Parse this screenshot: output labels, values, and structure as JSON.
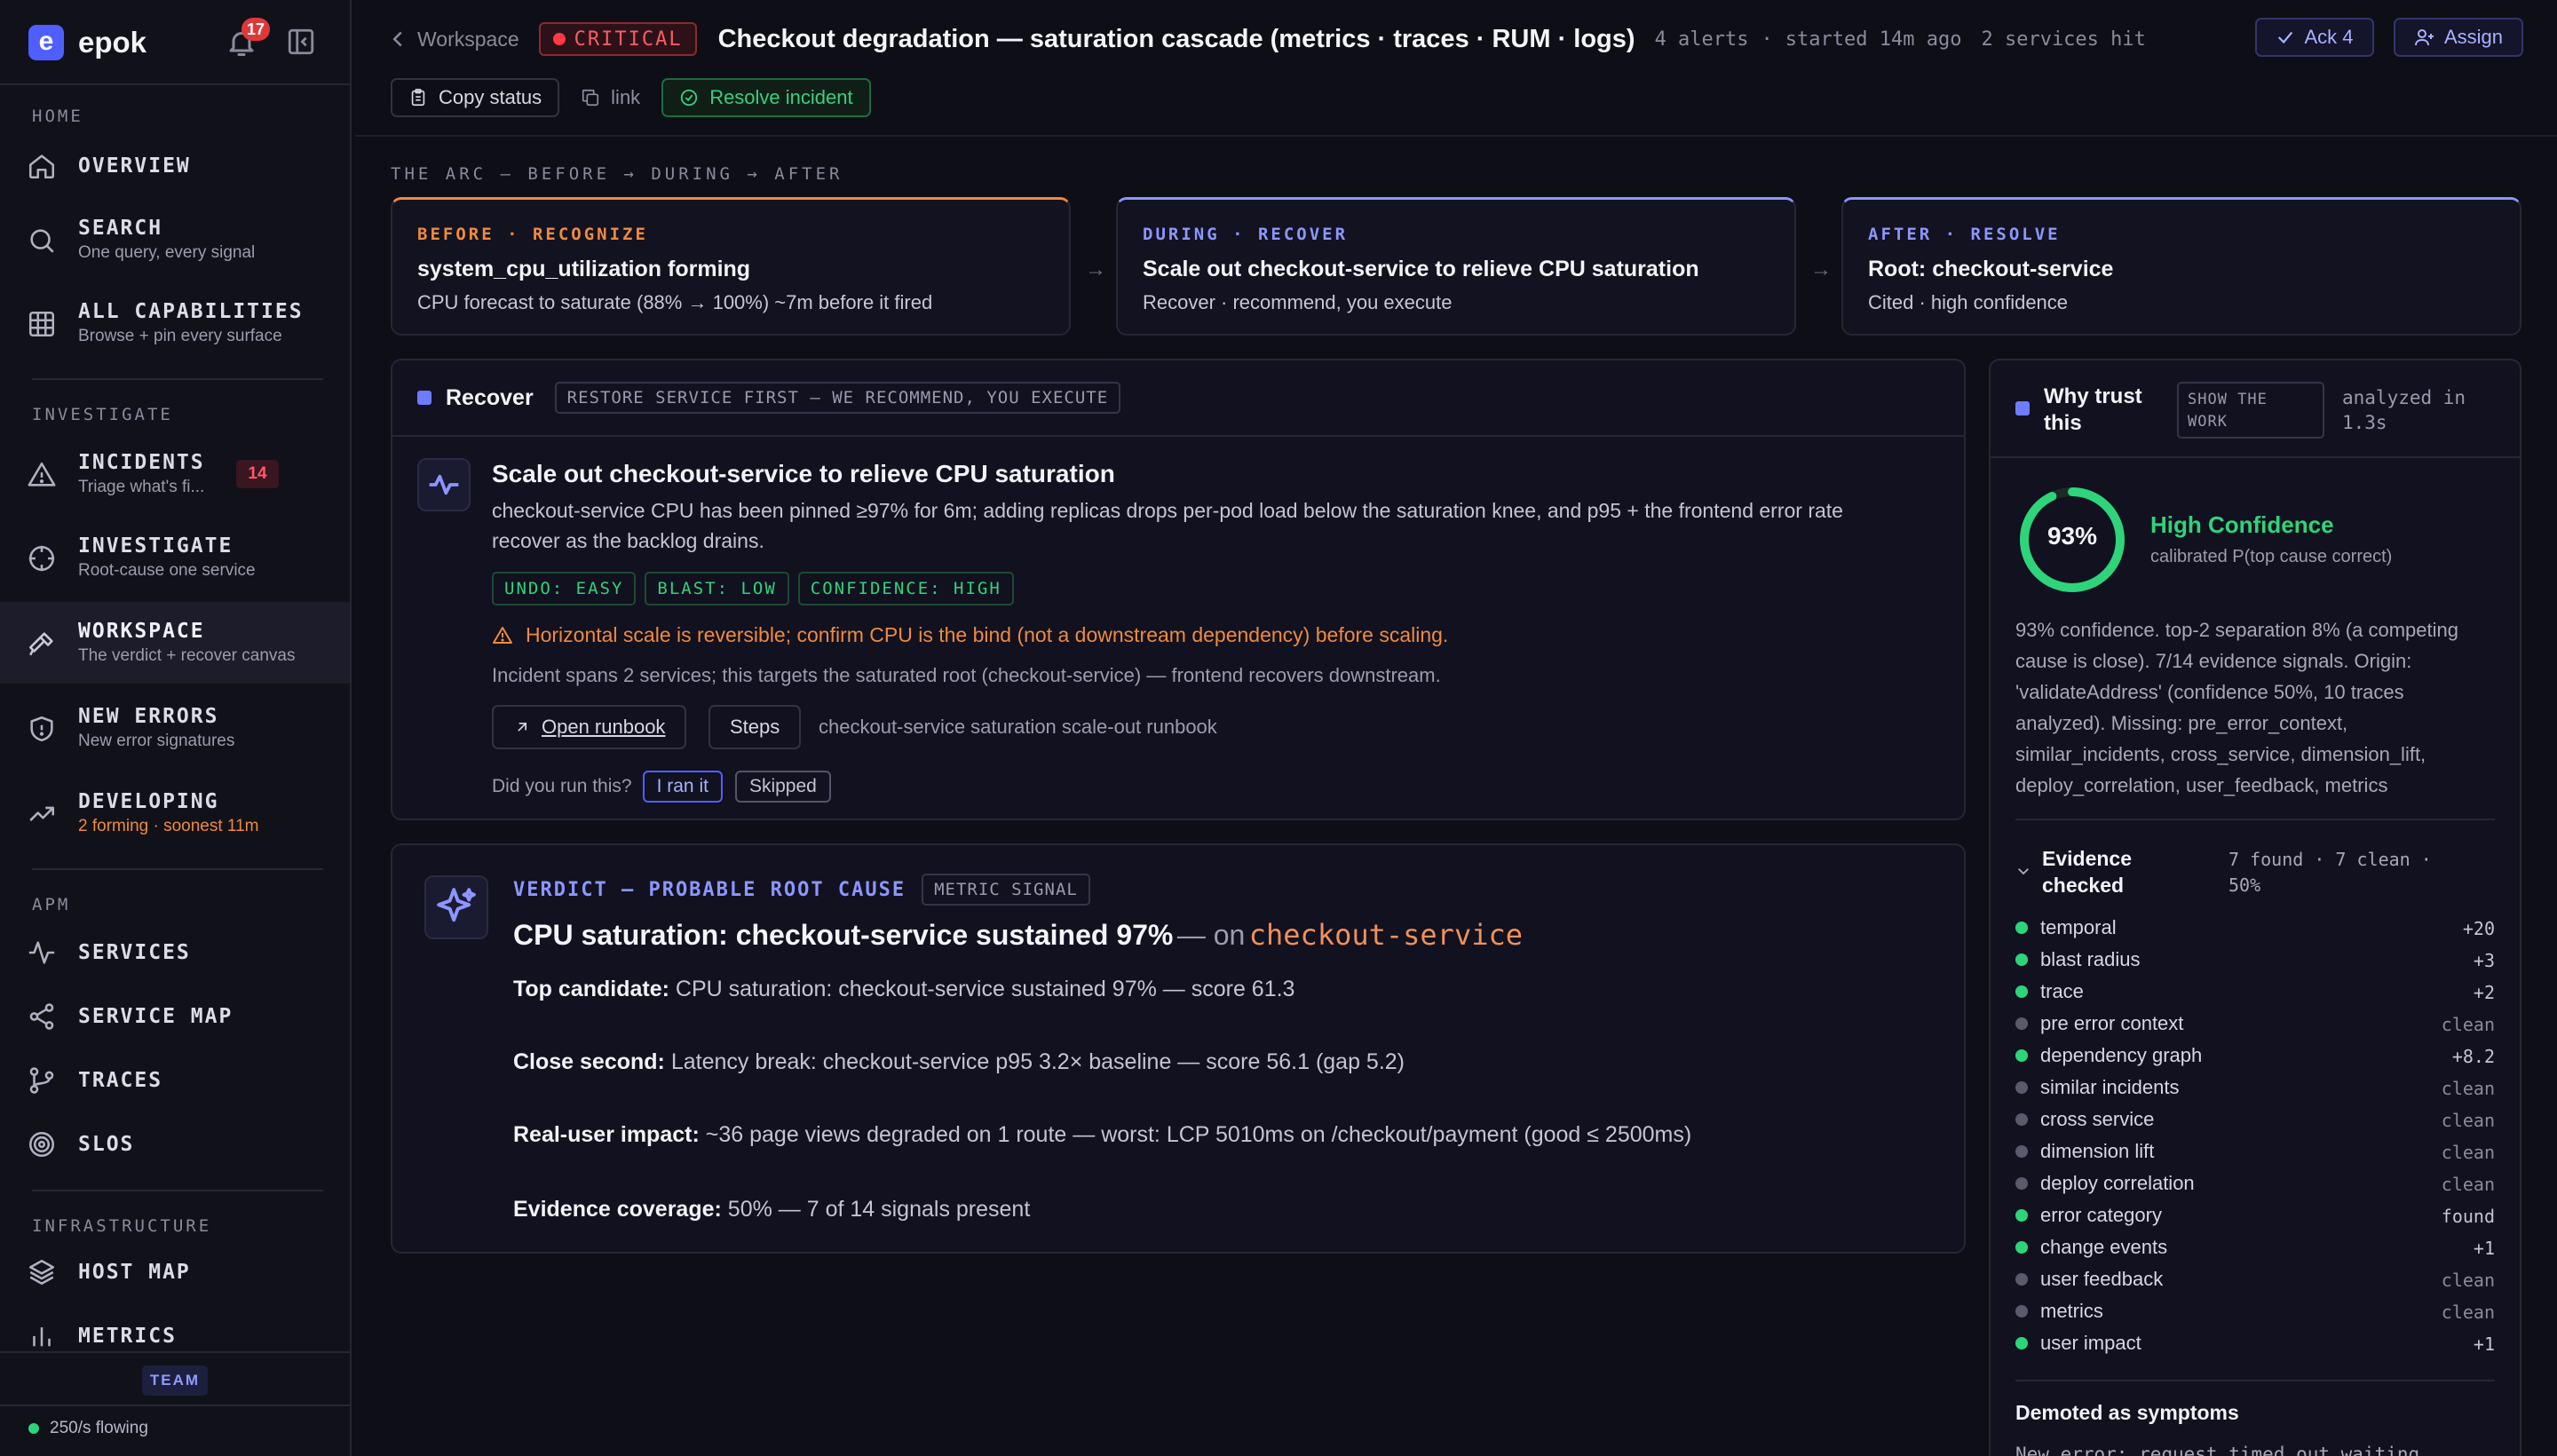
{
  "brand": {
    "name": "epok",
    "logo_letter": "e",
    "notif_count": "17"
  },
  "sidebar": {
    "sections": {
      "home": "HOME",
      "investigate": "INVESTIGATE",
      "apm": "APM",
      "infrastructure": "INFRASTRUCTURE"
    },
    "items": [
      {
        "label": "OVERVIEW",
        "icon": "home-icon"
      },
      {
        "label": "SEARCH",
        "sub": "One query, every signal",
        "icon": "search-icon"
      },
      {
        "label": "ALL CAPABILITIES",
        "sub": "Browse + pin every surface",
        "icon": "grid-icon"
      },
      {
        "label": "INCIDENTS",
        "sub": "Triage what's fi...",
        "badge": "14",
        "icon": "alert-triangle-icon"
      },
      {
        "label": "INVESTIGATE",
        "sub": "Root-cause one service",
        "icon": "crosshair-icon"
      },
      {
        "label": "WORKSPACE",
        "sub": "The verdict + recover canvas",
        "icon": "hammer-icon",
        "active": true
      },
      {
        "label": "NEW ERRORS",
        "sub": "New error signatures",
        "icon": "shield-icon"
      },
      {
        "label": "DEVELOPING",
        "sub": "2 forming · soonest 11m",
        "icon": "trend-up-icon"
      },
      {
        "label": "SERVICES",
        "icon": "pulse-icon"
      },
      {
        "label": "SERVICE MAP",
        "icon": "share-icon"
      },
      {
        "label": "TRACES",
        "icon": "branch-icon"
      },
      {
        "label": "SLOS",
        "icon": "target-icon"
      },
      {
        "label": "HOST MAP",
        "icon": "layers-icon"
      },
      {
        "label": "METRICS",
        "icon": "bar-chart-icon"
      }
    ],
    "team_label": "TEAM",
    "flow_status": "250/s flowing"
  },
  "header": {
    "breadcrumb": "Workspace",
    "severity": "CRITICAL",
    "title": "Checkout degradation — saturation cascade (metrics · traces · RUM · logs)",
    "alerts": "4 alerts",
    "started": "started 14m ago",
    "services": "2 services hit",
    "ack_label": "Ack 4",
    "assign_label": "Assign",
    "copy_status": "Copy status",
    "link": "link",
    "resolve": "Resolve incident"
  },
  "arc": {
    "heading": "THE ARC — BEFORE → DURING → AFTER",
    "steps": [
      {
        "kicker": "BEFORE · RECOGNIZE",
        "title": "system_cpu_utilization forming",
        "sub": "CPU forecast to saturate (88% → 100%) ~7m before it fired",
        "color": "#f08a3c"
      },
      {
        "kicker": "DURING · RECOVER",
        "title": "Scale out checkout-service to relieve CPU saturation",
        "sub": "Recover · recommend, you execute",
        "color": "#8c96ff"
      },
      {
        "kicker": "AFTER · RESOLVE",
        "title": "Root: checkout-service",
        "sub": "Cited · high confidence",
        "color": "#8c96ff"
      }
    ]
  },
  "recover": {
    "title": "Recover",
    "tag": "RESTORE SERVICE FIRST — WE RECOMMEND, YOU EXECUTE",
    "action_title": "Scale out checkout-service to relieve CPU saturation",
    "desc_1": "checkout-service CPU has been pinned ≥97% for 6m; adding replicas drops per-pod load below the saturation knee, and p95 + the frontend error rate",
    "desc_2": "recover as the backlog drains.",
    "tags": [
      "UNDO: EASY",
      "BLAST: LOW",
      "CONFIDENCE: HIGH"
    ],
    "warning": "Horizontal scale is reversible; confirm CPU is the bind (not a downstream dependency) before scaling.",
    "note": "Incident spans 2 services; this targets the saturated root (checkout-service) — frontend recovers downstream.",
    "open_runbook": "Open runbook",
    "steps": "Steps",
    "runbook_name": "checkout-service saturation scale-out runbook",
    "ran_q": "Did you run this?",
    "ran_it": "I ran it",
    "skipped": "Skipped"
  },
  "verdict": {
    "kicker": "VERDICT — PROBABLE ROOT CAUSE",
    "tag": "METRIC SIGNAL",
    "headline": "CPU saturation: checkout-service sustained 97%",
    "on": "— on",
    "service": "checkout-service",
    "rows": [
      {
        "label": "Top candidate:",
        "value": "CPU saturation: checkout-service sustained 97% — score 61.3"
      },
      {
        "label": "Close second:",
        "value": "Latency break: checkout-service p95 3.2× baseline — score 56.1 (gap 5.2)"
      },
      {
        "label": "Real-user impact:",
        "value": "~36 page views degraded on 1 route — worst: LCP 5010ms on /checkout/payment (good ≤ 2500ms)"
      },
      {
        "label": "Evidence coverage:",
        "value": "50% — 7 of 14 signals present"
      }
    ]
  },
  "trust": {
    "title_1": "Why trust",
    "title_2": "this",
    "show_work_1": "SHOW THE",
    "show_work_2": "WORK",
    "analyzed_1": "analyzed in",
    "analyzed_2": "1.3s",
    "confidence_pct": "93%",
    "confidence_value": 0.93,
    "confidence_label": "High Confidence",
    "calibrated": "calibrated P(top cause correct)",
    "summary_lines": [
      "93% confidence. top-2 separation 8% (a competing",
      "cause is close). 7/14 evidence signals. Origin:",
      "'validateAddress' (confidence 50%, 10 traces",
      "analyzed). Missing: pre_error_context,",
      "similar_incidents, cross_service, dimension_lift,",
      "deploy_correlation, user_feedback, metrics"
    ],
    "evidence_title_1": "Evidence",
    "evidence_title_2": "checked",
    "evidence_stats_1": "7 found · 7 clean ·",
    "evidence_stats_2": "50%",
    "evidence": [
      {
        "name": "temporal",
        "value": "+20",
        "found": true
      },
      {
        "name": "blast radius",
        "value": "+3",
        "found": true
      },
      {
        "name": "trace",
        "value": "+2",
        "found": true
      },
      {
        "name": "pre error context",
        "value": "clean",
        "found": false
      },
      {
        "name": "dependency graph",
        "value": "+8.2",
        "found": true
      },
      {
        "name": "similar incidents",
        "value": "clean",
        "found": false
      },
      {
        "name": "cross service",
        "value": "clean",
        "found": false
      },
      {
        "name": "dimension lift",
        "value": "clean",
        "found": false
      },
      {
        "name": "deploy correlation",
        "value": "clean",
        "found": false
      },
      {
        "name": "error category",
        "value": "found",
        "found": true
      },
      {
        "name": "change events",
        "value": "+1",
        "found": true
      },
      {
        "name": "user feedback",
        "value": "clean",
        "found": false
      },
      {
        "name": "metrics",
        "value": "clean",
        "found": false
      },
      {
        "name": "user impact",
        "value": "+1",
        "found": true
      }
    ],
    "demoted_title": "Demoted as symptoms",
    "demoted_first": "New error: request timed out waiting"
  },
  "colors": {
    "accent": "#6b7cff",
    "critical": "#ff3a46",
    "success": "#2ed47a",
    "warning": "#f08a3c"
  }
}
